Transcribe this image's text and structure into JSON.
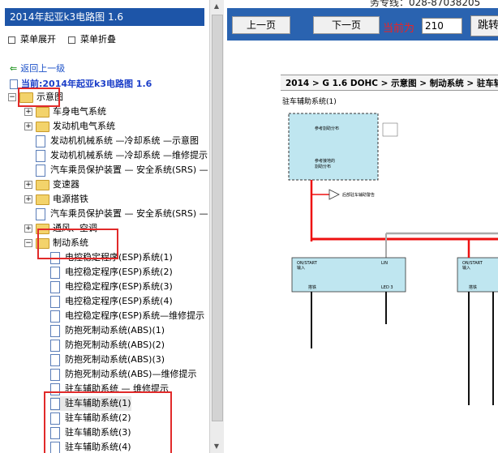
{
  "left": {
    "title": "2014年起亚k3电路图 1.6",
    "menu_expand": "菜单展开",
    "menu_collapse": "菜单折叠",
    "back": "返回上一级",
    "current": "当前:2014年起亚k3电路图 1.6",
    "root": "示意图",
    "items": [
      "车身电气系统",
      "发动机电气系统",
      "发动机机械系统 —冷却系统 —示意图",
      "发动机机械系统 —冷却系统 —维修提示",
      "汽车乘员保护装置 — 安全系统(SRS) —",
      "变速器",
      "电源搭铁",
      "汽车乘员保护装置 — 安全系统(SRS) —",
      "通风、空调",
      "制动系统",
      "电控稳定程序(ESP)系统(1)",
      "电控稳定程序(ESP)系统(2)",
      "电控稳定程序(ESP)系统(3)",
      "电控稳定程序(ESP)系统(4)",
      "电控稳定程序(ESP)系统—维修提示",
      "防抱死制动系统(ABS)(1)",
      "防抱死制动系统(ABS)(2)",
      "防抱死制动系统(ABS)(3)",
      "防抱死制动系统(ABS)—维修提示",
      "驻车辅助系统 — 维修提示",
      "驻车辅助系统(1)",
      "驻车辅助系统(2)",
      "驻车辅助系统(3)",
      "驻车辅助系统(4)"
    ]
  },
  "right": {
    "hotline": "务专线：028-87038205",
    "prev": "上一页",
    "next": "下一页",
    "current_label": "当前为",
    "page_value": "210",
    "jump": "跳转",
    "breadcrumb": "2014 > G 1.6 DOHC > 示意图 > 制动系统 > 驻车辅助系",
    "diagram_title": "驻车辅助系统(1)",
    "diagram": {
      "box1_l1": "参考割助分布",
      "box1_l2": "参考接地的",
      "box1_l3": "割助分布",
      "left_block_top": "ON/START",
      "left_block_sub": "输入",
      "left_block_lin": "LIN",
      "left_block_bottom": "搭铁",
      "left_block_led": "LED 3",
      "right_block_top": "ON/START",
      "right_block_sub": "输入",
      "right_block_bottom": "搭铁",
      "right_block_led": "LED 3",
      "warn": "后部驻车辅助警告"
    }
  }
}
